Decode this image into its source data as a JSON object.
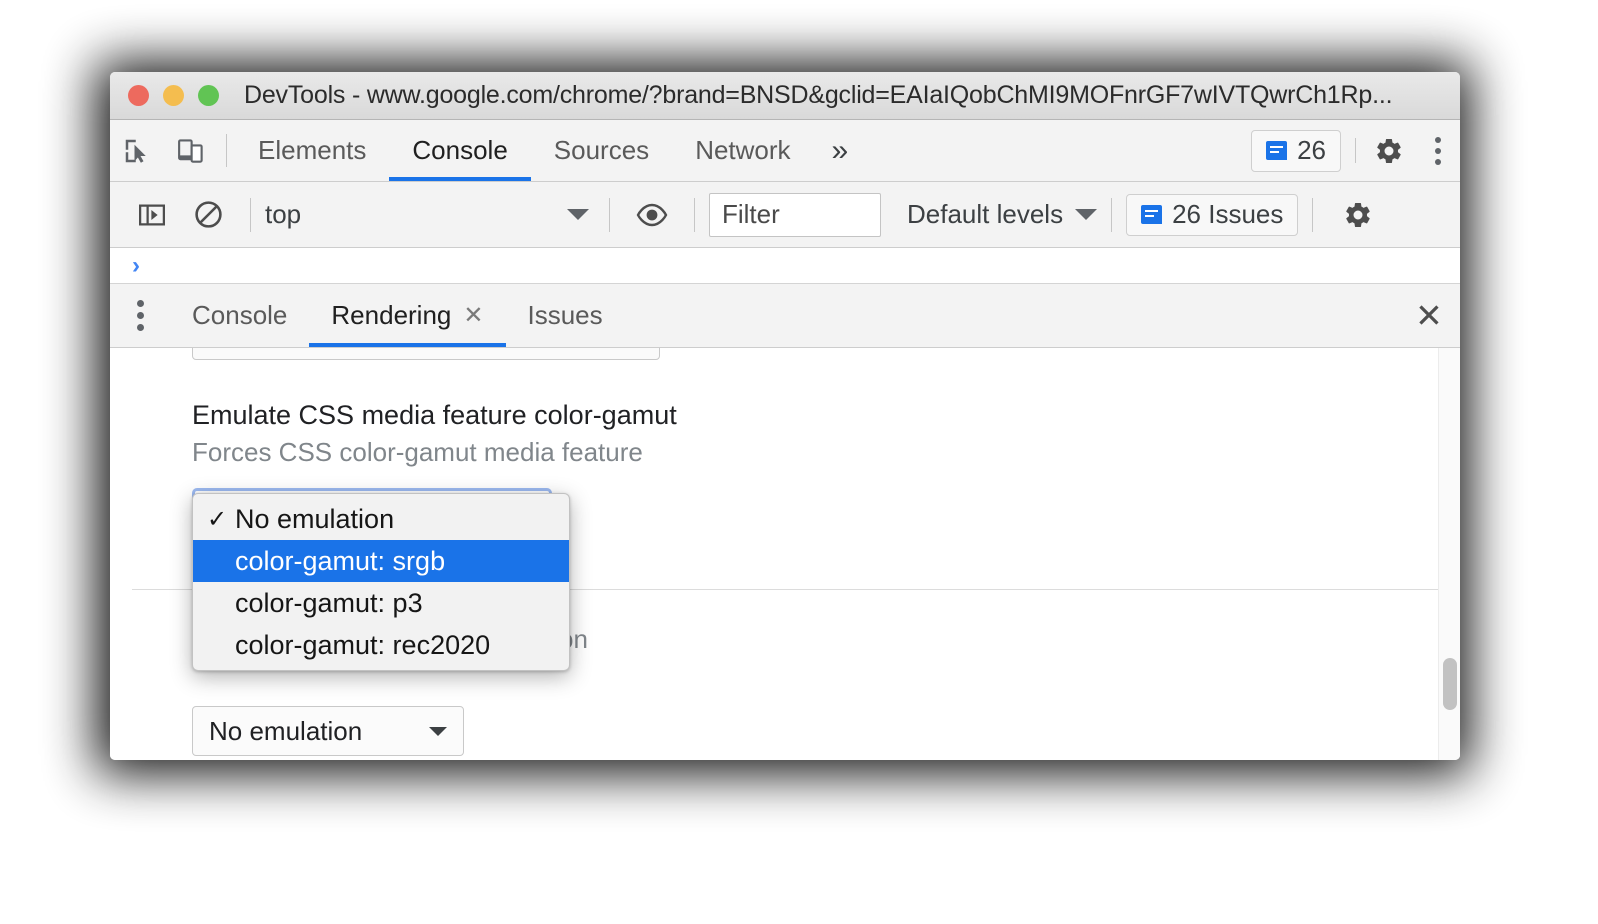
{
  "window": {
    "title": "DevTools - www.google.com/chrome/?brand=BNSD&gclid=EAIaIQobChMI9MOFnrGF7wIVTQwrCh1Rp...",
    "traffic_lights": [
      {
        "name": "close",
        "color": "#ED6A5E"
      },
      {
        "name": "minimize",
        "color": "#F4BD4F"
      },
      {
        "name": "zoom",
        "color": "#61C454"
      }
    ]
  },
  "main_toolbar": {
    "inspect_icon": "inspect-element-icon",
    "device_icon": "device-toolbar-icon",
    "tabs": [
      {
        "label": "Elements",
        "active": false
      },
      {
        "label": "Console",
        "active": true
      },
      {
        "label": "Sources",
        "active": false
      },
      {
        "label": "Network",
        "active": false
      }
    ],
    "more_tabs_label": "»",
    "issues_count": "26",
    "settings_icon": "gear-icon",
    "more_icon": "kebab-menu-icon"
  },
  "console_toolbar": {
    "sidebar_toggle_icon": "console-sidebar-icon",
    "clear_icon": "clear-console-icon",
    "context": "top",
    "eye_icon": "live-expression-icon",
    "filter_placeholder": "Filter",
    "filter_value": "",
    "levels_label": "Default levels",
    "issues_label": "26 Issues",
    "settings_icon": "gear-icon"
  },
  "console_prompt": {
    "chevron": "›"
  },
  "drawer": {
    "more_icon": "kebab-menu-icon",
    "tabs": [
      {
        "label": "Console",
        "active": false,
        "closeable": false
      },
      {
        "label": "Rendering",
        "active": true,
        "closeable": true,
        "close_glyph": "✕"
      },
      {
        "label": "Issues",
        "active": false,
        "closeable": false
      }
    ],
    "close_glyph": "✕"
  },
  "rendering_panel": {
    "settings": [
      {
        "title": "Emulate CSS media feature color-gamut",
        "description": "Forces CSS color-gamut media feature",
        "selected_value": "No emulation"
      },
      {
        "title": "",
        "description": "Forces vision deficiency emulation",
        "selected_value": "No emulation"
      }
    ],
    "popup": {
      "check_glyph": "✓",
      "items": [
        {
          "label": "No emulation",
          "checked": true,
          "highlighted": false
        },
        {
          "label": "color-gamut: srgb",
          "checked": false,
          "highlighted": true
        },
        {
          "label": "color-gamut: p3",
          "checked": false,
          "highlighted": false
        },
        {
          "label": "color-gamut: rec2020",
          "checked": false,
          "highlighted": false
        }
      ]
    }
  },
  "colors": {
    "accent": "#1a73e8",
    "titlebar_text": "#2b2b2b",
    "secondary_text": "#80868b"
  }
}
